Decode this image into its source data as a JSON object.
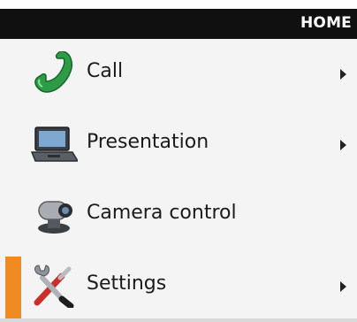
{
  "header": {
    "title": "HOME"
  },
  "menu": {
    "items": [
      {
        "label": "Call",
        "icon": "phone-icon",
        "has_submenu": true
      },
      {
        "label": "Presentation",
        "icon": "laptop-icon",
        "has_submenu": true
      },
      {
        "label": "Camera control",
        "icon": "camera-icon",
        "has_submenu": false
      },
      {
        "label": "Settings",
        "icon": "tools-icon",
        "has_submenu": true,
        "selected": true
      }
    ]
  },
  "colors": {
    "header_bg": "#101010",
    "accent": "#f08a22",
    "phone_green": "#2e9c46"
  }
}
